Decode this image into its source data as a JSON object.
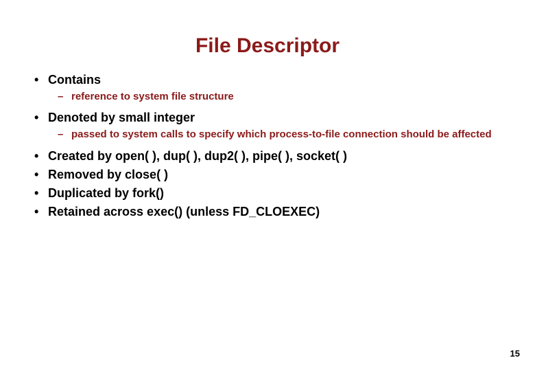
{
  "title": "File Descriptor",
  "bullets": {
    "b0": {
      "label": "Contains",
      "sub": {
        "s0": "reference to system file structure"
      }
    },
    "b1": {
      "label": "Denoted by small integer",
      "sub": {
        "s0": "passed to system calls to specify which process-to-file connection should be affected"
      }
    },
    "b2": {
      "label": "Created by open( ), dup( ), dup2( ), pipe( ), socket( )"
    },
    "b3": {
      "label": "Removed by close( )"
    },
    "b4": {
      "label": "Duplicated by fork()"
    },
    "b5": {
      "label_pre": "Retained across exec() (unless ",
      "const": "FD_CLOEXEC",
      "label_post": ")"
    }
  },
  "page_number": "15"
}
